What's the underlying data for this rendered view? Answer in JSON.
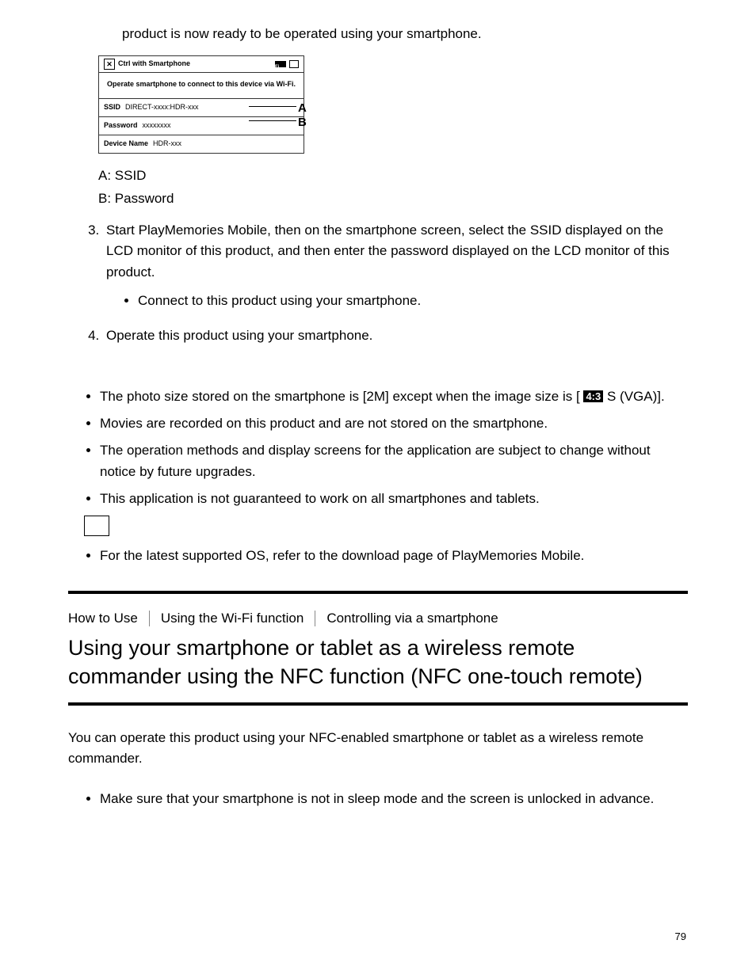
{
  "top_line": "product is now ready to be operated using your smartphone.",
  "lcd": {
    "close_glyph": "✕",
    "title": "Ctrl with Smartphone",
    "badge": "Wi-Fi",
    "message": "Operate smartphone to connect to this device via Wi-Fi.",
    "rows": {
      "ssid_label": "SSID",
      "ssid_value": "DIRECT-xxxx:HDR-xxx",
      "pw_label": "Password",
      "pw_value": "xxxxxxxx",
      "dev_label": "Device Name",
      "dev_value": "HDR-xxx"
    },
    "labelA": "A",
    "labelB": "B"
  },
  "caption": {
    "lineA": "A: SSID",
    "lineB": "B: Password"
  },
  "steps": {
    "s3": "Start PlayMemories Mobile, then on the smartphone screen, select the SSID displayed on the LCD monitor of this product, and then enter the password displayed on the LCD monitor of this product.",
    "s3_sub": "Connect to this product using your smartphone.",
    "s4": "Operate this product using your smartphone."
  },
  "notes": {
    "n1a": "The photo size stored on the smartphone is [2M] except when the image size is [",
    "n1_badge": "4:3",
    "n1b": " S (VGA)].",
    "n2": "Movies are recorded on this product and are not stored on the smartphone.",
    "n3": "The operation methods and display screens for the application are subject to change without notice by future upgrades.",
    "n4": "This application is not guaranteed to work on all smartphones and tablets.",
    "n5": "For the latest supported OS, refer to the download page of PlayMemories Mobile."
  },
  "section": {
    "crumb1": "How to Use",
    "crumb2": "Using the Wi-Fi function",
    "crumb3": "Controlling via a smartphone",
    "heading": "Using your smartphone or tablet as a wireless remote commander using the NFC function (NFC one-touch remote)",
    "intro": "You can operate this product using your NFC-enabled smartphone or tablet as a wireless remote commander.",
    "prep1": "Make sure that your smartphone is not in sleep mode and the screen is unlocked in advance."
  },
  "page_number": "79"
}
